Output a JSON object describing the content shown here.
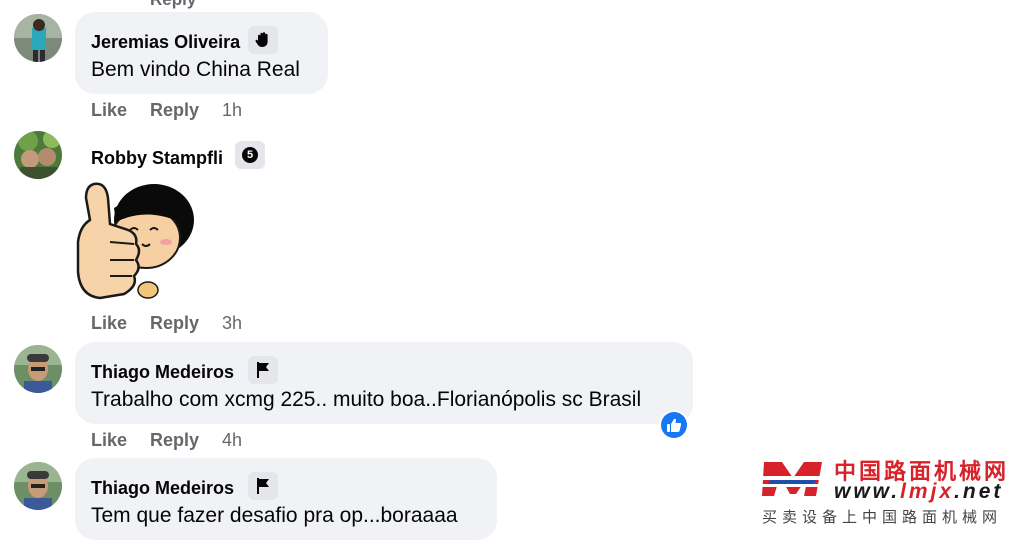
{
  "top_cut_text": "Reply",
  "comments": [
    {
      "author": "Jeremias Oliveira",
      "badge_icon": "wave-hand-icon",
      "text": "Bem vindo China Real",
      "like": "Like",
      "reply": "Reply",
      "time": "1h"
    },
    {
      "author": "Robby Stampfli",
      "badge_icon": "five-coin-icon",
      "badge_text": "5",
      "sticker": "thumbs-up-girl-sticker",
      "like": "Like",
      "reply": "Reply",
      "time": "3h"
    },
    {
      "author": "Thiago Medeiros",
      "badge_icon": "flag-icon",
      "text": "Trabalho com xcmg 225.. muito boa..Florianópolis sc Brasil",
      "reaction_icon": "like-reaction-icon",
      "like": "Like",
      "reply": "Reply",
      "time": "4h"
    },
    {
      "author": "Thiago Medeiros",
      "badge_icon": "flag-icon",
      "text": "Tem que fazer desafio pra op...boraaaa"
    }
  ],
  "watermark": {
    "chinese_name": "中国路面机械网",
    "url_prefix": "www.",
    "url_domain": "lmjx",
    "url_suffix": ".net",
    "subtitle": "买卖设备上中国路面机械网",
    "brand_colors": {
      "red": "#d7222a",
      "blue": "#1f4fa8"
    }
  }
}
